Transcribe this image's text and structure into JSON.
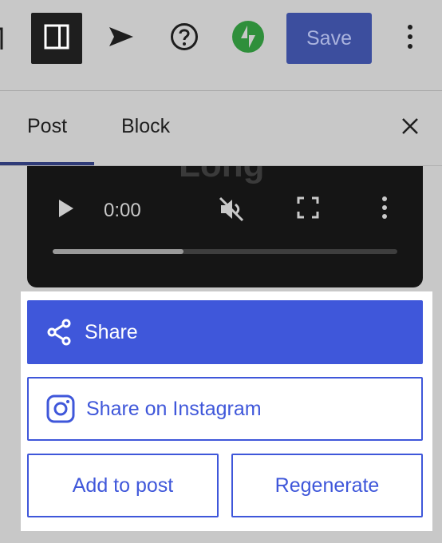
{
  "toolbar": {
    "save_label": "Save"
  },
  "sidebar": {
    "tabs": [
      {
        "label": "Post",
        "active": true
      },
      {
        "label": "Block",
        "active": false
      }
    ]
  },
  "video": {
    "time": "0:00",
    "background_text": "Long",
    "progress_fraction": 0.38
  },
  "share": {
    "share_label": "Share",
    "instagram_label": "Share on Instagram",
    "add_to_post_label": "Add to post",
    "regenerate_label": "Regenerate"
  },
  "colors": {
    "accent": "#3f57da",
    "save_button": "#3c4e9e",
    "jetpack_green": "#2f8f3b",
    "toolbar_bg": "#c8c8c8"
  }
}
